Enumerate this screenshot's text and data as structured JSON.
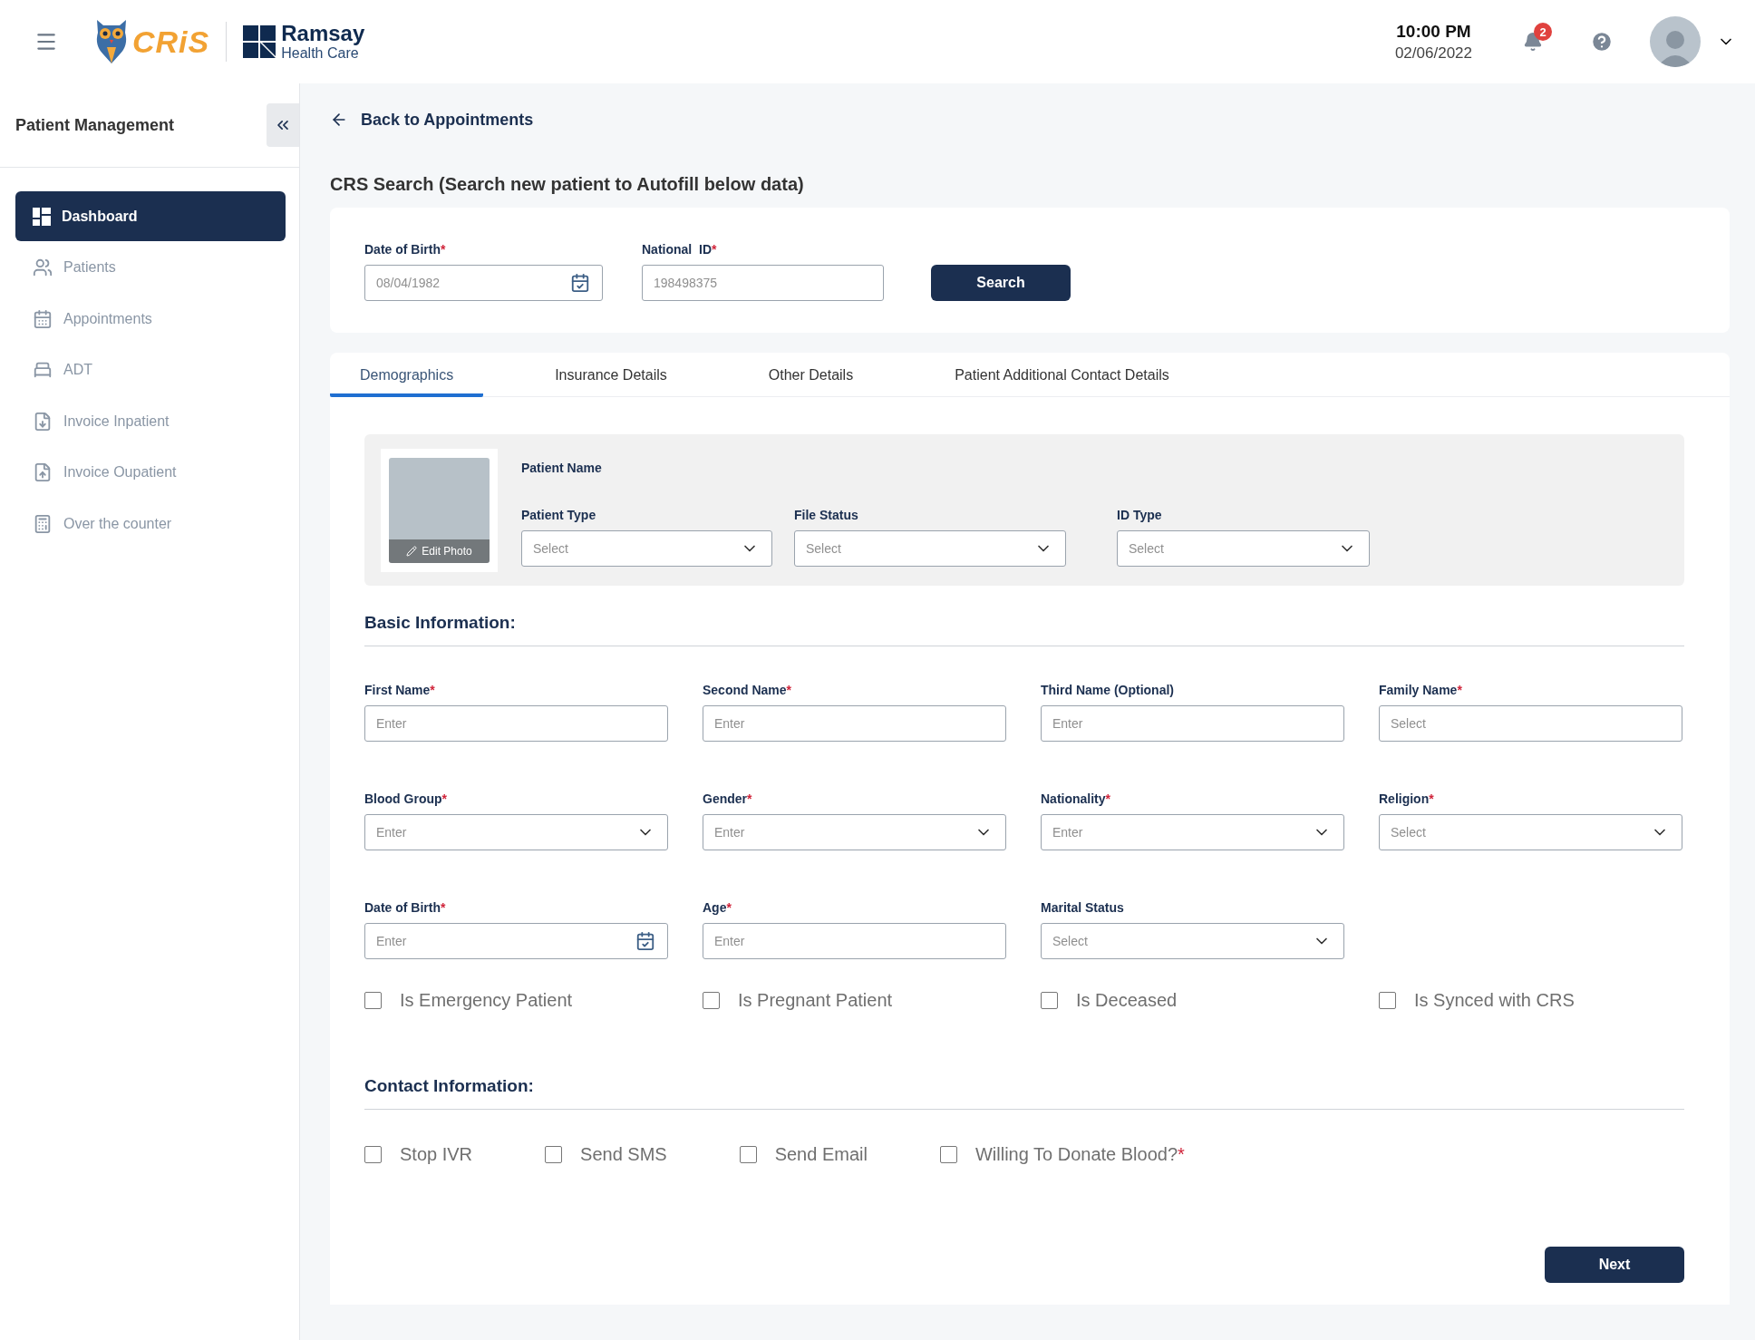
{
  "header": {
    "logo_text": "CRiS",
    "brand_name": "Ramsay",
    "brand_subtitle": "Health Care",
    "time": "10:00 PM",
    "date": "02/06/2022",
    "notification_count": "2"
  },
  "sidebar": {
    "title": "Patient Management",
    "items": [
      {
        "label": "Dashboard",
        "kind": "dashboard",
        "selected": true
      },
      {
        "label": "Patients",
        "kind": "patients",
        "selected": false
      },
      {
        "label": "Appointments",
        "kind": "appointments",
        "selected": false
      },
      {
        "label": "ADT",
        "kind": "adt",
        "selected": false
      },
      {
        "label": "Invoice Inpatient",
        "kind": "invoice_in",
        "selected": false
      },
      {
        "label": "Invoice Oupatient",
        "kind": "invoice_out",
        "selected": false
      },
      {
        "label": "Over the counter",
        "kind": "counter",
        "selected": false
      }
    ]
  },
  "back_link": "Back to Appointments",
  "crs_search": {
    "title": "CRS Search (Search new patient to Autofill below data)",
    "fields": [
      {
        "label": "Date of Birth",
        "required_mark": "*",
        "kind": "date",
        "placeholder": "08/04/1982"
      },
      {
        "label": "National  ID",
        "required_mark": "*",
        "kind": "text",
        "placeholder": "198498375"
      }
    ],
    "button": "Search"
  },
  "tabs": [
    {
      "label": "Demographics",
      "selected": true
    },
    {
      "label": "Insurance Details",
      "selected": false
    },
    {
      "label": "Other Details",
      "selected": false
    },
    {
      "label": "Patient Additional Contact Details",
      "selected": false
    }
  ],
  "photo": {
    "action": "Edit Photo"
  },
  "patient_name_label": "Patient Name",
  "patient_fields": [
    {
      "label": "Patient Type",
      "kind": "select",
      "placeholder": "Select"
    },
    {
      "label": "File Status",
      "kind": "select",
      "placeholder": "Select"
    },
    {
      "label": "ID Type",
      "kind": "select",
      "placeholder": "Select"
    }
  ],
  "basic_information": {
    "title": "Basic Information:",
    "fields": [
      {
        "label": "First Name",
        "required_mark": "*",
        "kind": "text",
        "placeholder": "Enter"
      },
      {
        "label": "Second Name",
        "required_mark": "*",
        "kind": "text",
        "placeholder": "Enter"
      },
      {
        "label": "Third Name (Optional)",
        "kind": "text",
        "placeholder": "Enter"
      },
      {
        "label": "Family Name",
        "required_mark": "*",
        "kind": "text",
        "placeholder": "Select"
      },
      {
        "label": "Blood Group",
        "required_mark": "*",
        "kind": "select",
        "placeholder": "Enter"
      },
      {
        "label": "Gender",
        "required_mark": "*",
        "kind": "select",
        "placeholder": "Enter"
      },
      {
        "label": "Nationality",
        "required_mark": "*",
        "kind": "select",
        "placeholder": "Enter"
      },
      {
        "label": "Religion",
        "required_mark": "*",
        "kind": "select",
        "placeholder": "Select"
      },
      {
        "label": "Date of Birth",
        "required_mark": "*",
        "kind": "date",
        "placeholder": "Enter"
      },
      {
        "label": "Age",
        "required_mark": "*",
        "kind": "text",
        "placeholder": "Enter"
      },
      {
        "label": "Marital Status",
        "kind": "select",
        "placeholder": "Select"
      }
    ],
    "checkboxes": [
      {
        "label": "Is Emergency Patient",
        "checked": false
      },
      {
        "label": "Is Pregnant Patient",
        "checked": false
      },
      {
        "label": "Is Deceased",
        "checked": false
      },
      {
        "label": "Is Synced with CRS",
        "checked": false
      }
    ]
  },
  "contact_information": {
    "title": "Contact Information:",
    "checkboxes": [
      {
        "label": "Stop IVR",
        "checked": false
      },
      {
        "label": "Send SMS",
        "checked": false
      },
      {
        "label": "Send Email",
        "checked": false
      },
      {
        "label": "Willing To Donate Blood?",
        "required_mark": "*",
        "checked": false
      }
    ]
  },
  "next_button": "Next"
}
